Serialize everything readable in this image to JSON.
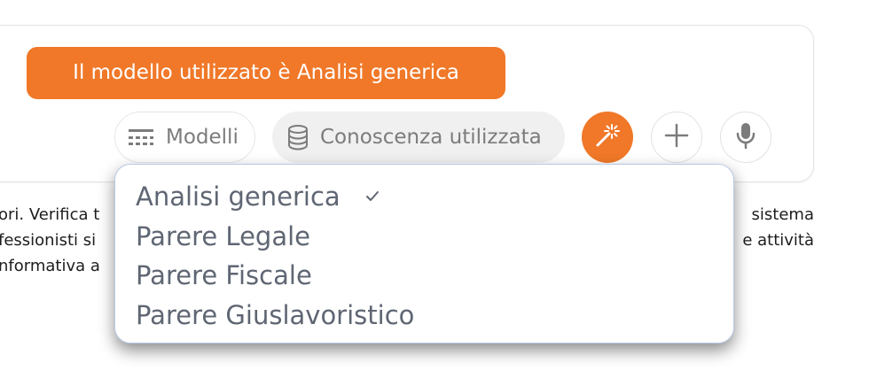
{
  "composer": {
    "model_banner": "Il modello utilizzato è Analisi generica",
    "models_button": {
      "label": "Modelli",
      "icon": "models-list-icon"
    },
    "knowledge_button": {
      "label": "Conoscenza utilizzata",
      "icon": "database-icon"
    },
    "magic_button": {
      "icon": "magic-wand-icon"
    },
    "add_button": {
      "icon": "plus-icon"
    },
    "mic_button": {
      "icon": "microphone-icon"
    }
  },
  "background_text": {
    "lines": [
      {
        "left": "ori. Verifica t",
        "right": "sistema"
      },
      {
        "left": "fessionisti si",
        "right": "e attività"
      },
      {
        "left": "nformativa a",
        "right": ""
      }
    ]
  },
  "models_dropdown": {
    "items": [
      {
        "label": "Analisi generica",
        "selected": true
      },
      {
        "label": "Parere Legale",
        "selected": false
      },
      {
        "label": "Parere Fiscale",
        "selected": false
      },
      {
        "label": "Parere Giuslavoristico",
        "selected": false
      }
    ]
  },
  "colors": {
    "accent": "#f07828",
    "dropdown_border": "#b8c8e6",
    "muted_text": "#7c7c7c"
  }
}
